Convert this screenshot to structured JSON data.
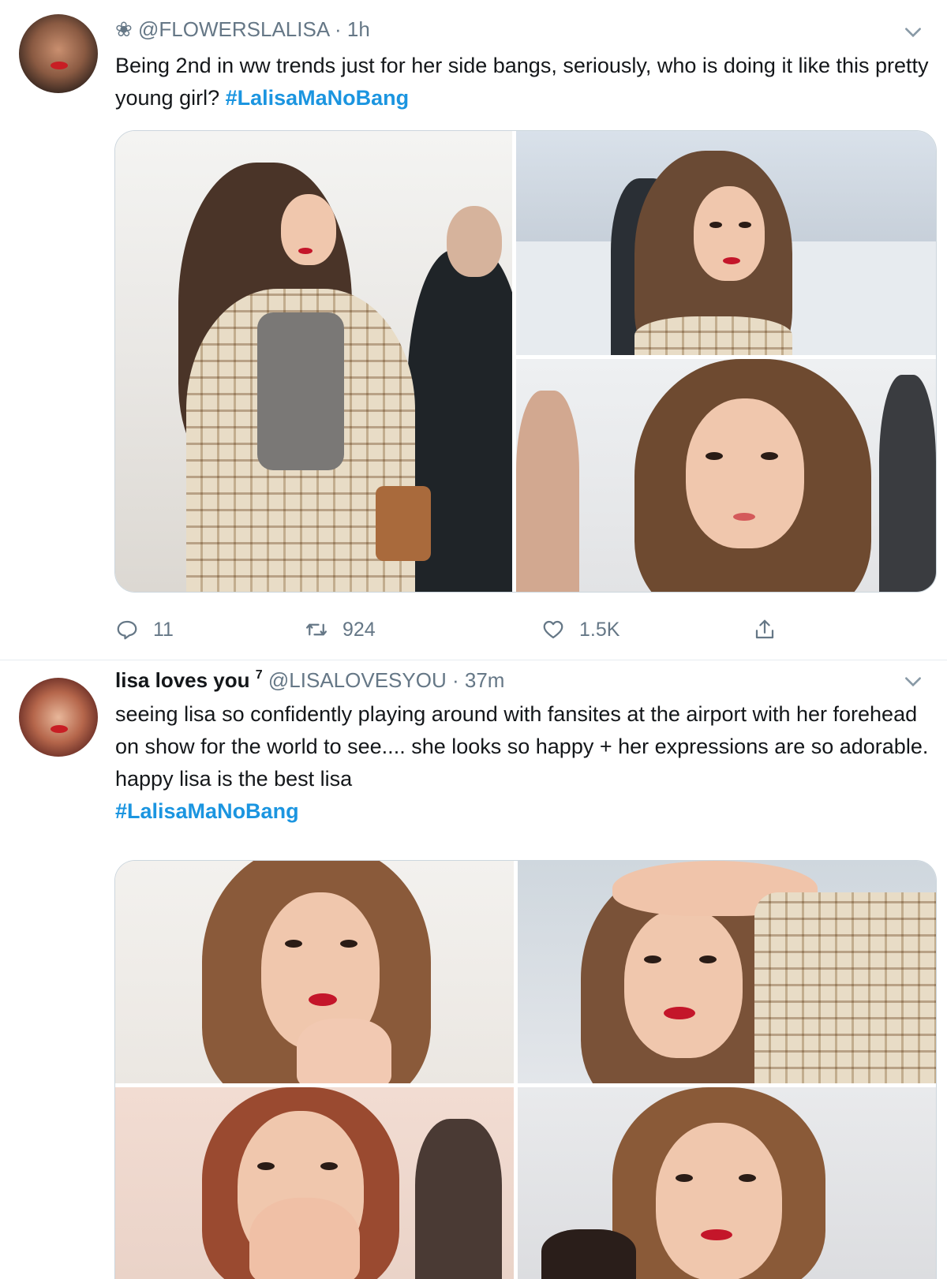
{
  "tweets": [
    {
      "handle_prefix": "❀",
      "handle": "@FLOWERSLALISA",
      "separator": "·",
      "time": "1h",
      "text": "Being 2nd in ww trends just for her side bangs, seriously, who is doing it like this pretty young girl?",
      "hashtag": "#LalisaMaNoBang",
      "stats": {
        "replies": "11",
        "retweets": "924",
        "likes": "1.5K"
      }
    },
    {
      "display_name": "lisa loves you",
      "display_name_sup": "7",
      "handle": "@LISALOVESYOU",
      "separator": "·",
      "time": "37m",
      "text": "seeing lisa so confidently playing around with fansites at the airport with her forehead on show for the world to see.... she looks so happy + her expressions are so adorable. happy lisa is the best lisa",
      "hashtag": "#LalisaMaNoBang"
    }
  ],
  "icons": {
    "more": "chevron-down-icon",
    "reply": "reply-icon",
    "retweet": "retweet-icon",
    "like": "heart-icon",
    "share": "share-icon"
  },
  "colors": {
    "hashtag": "#1b95e0",
    "secondary_text": "#657786",
    "border": "#e6ecf0"
  }
}
